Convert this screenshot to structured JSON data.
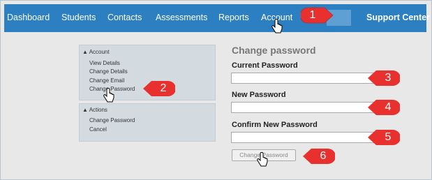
{
  "nav": {
    "items": [
      "Dashboard",
      "Students",
      "Contacts",
      "Assessments",
      "Reports",
      "Account"
    ],
    "support_label": "Support Center"
  },
  "sidebar": {
    "account_heading": "▲ Account",
    "account_links": [
      "View Details",
      "Change Details",
      "Change Email",
      "Change Password"
    ],
    "actions_heading": "▲ Actions",
    "actions_links": [
      "Change Password",
      "Cancel"
    ]
  },
  "form": {
    "title": "Change password",
    "current_label": "Current Password",
    "new_label": "New Password",
    "confirm_label": "Confirm New Password",
    "submit_label": "Change Password"
  },
  "callouts": [
    "1",
    "2",
    "3",
    "4",
    "5",
    "6"
  ],
  "colors": {
    "topbar": "#2c7fc1",
    "callout": "#e8312f"
  },
  "icons": {
    "cursor": "hand-pointer-icon"
  }
}
